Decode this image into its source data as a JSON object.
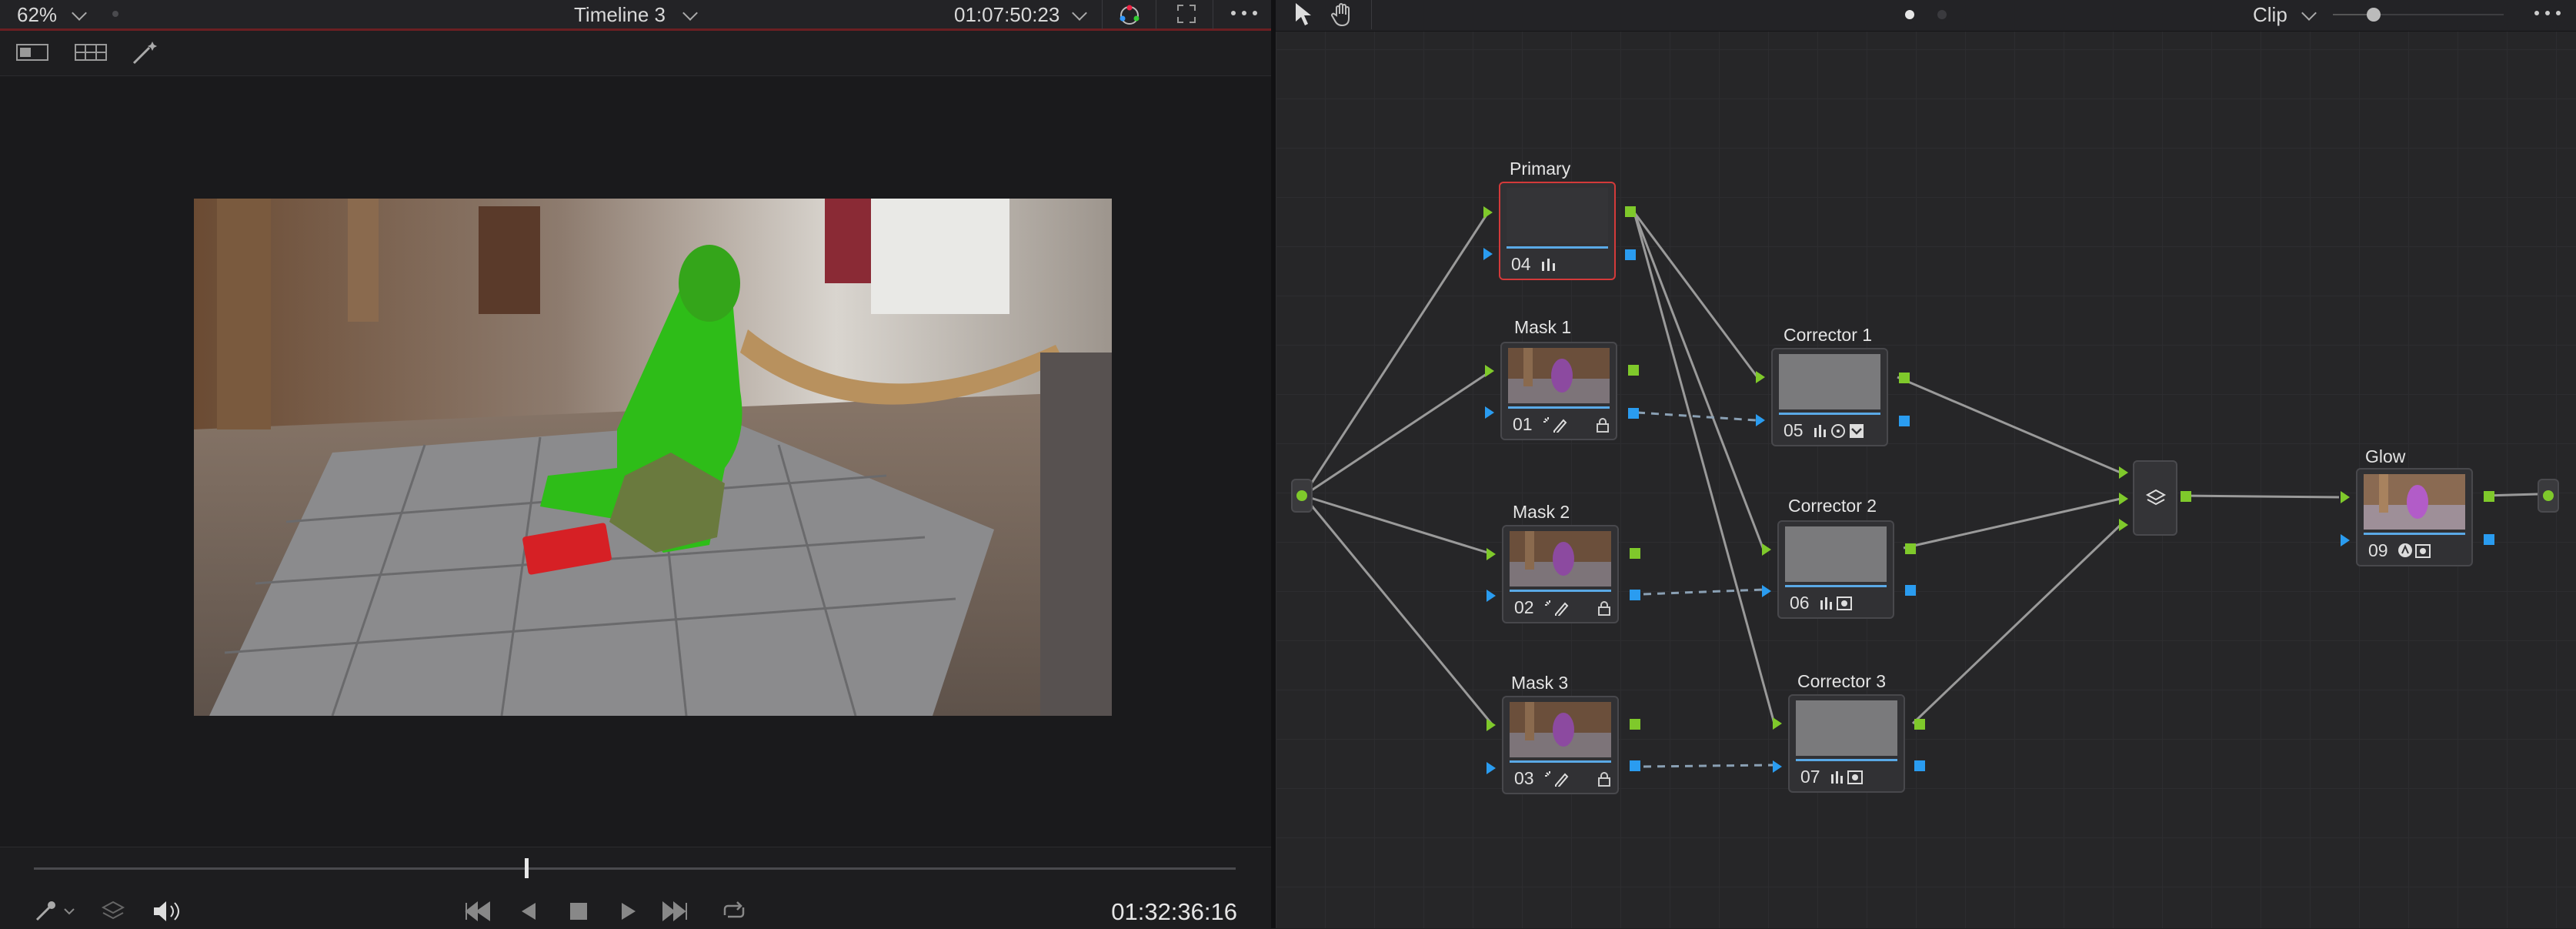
{
  "viewer": {
    "zoom": "62%",
    "timeline_name": "Timeline 3",
    "source_timecode": "01:07:50:23",
    "playhead_timecode": "01:32:36:16",
    "scrub_position": 0.41
  },
  "node_editor": {
    "mode_label": "Clip",
    "nodes": [
      {
        "id": "primary",
        "label": "Primary",
        "number": "04"
      },
      {
        "id": "mask1",
        "label": "Mask 1",
        "number": "01"
      },
      {
        "id": "mask2",
        "label": "Mask 2",
        "number": "02"
      },
      {
        "id": "mask3",
        "label": "Mask 3",
        "number": "03"
      },
      {
        "id": "corr1",
        "label": "Corrector 1",
        "number": "05"
      },
      {
        "id": "corr2",
        "label": "Corrector 2",
        "number": "06"
      },
      {
        "id": "corr3",
        "label": "Corrector 3",
        "number": "07"
      },
      {
        "id": "glow",
        "label": "Glow",
        "number": "09"
      }
    ]
  },
  "colors": {
    "rgb_output": "#7fc92b",
    "alpha_output": "#2a9cf0",
    "selected_node": "#d33a3a",
    "timeline_accent": "#6b1f22"
  },
  "icons": [
    "dropdown-chevron",
    "color-wheel-icon",
    "fullscreen-icon",
    "more-options-icon",
    "single-viewer-icon",
    "gallery-grid-icon",
    "magic-wand-icon",
    "pointer-icon",
    "hand-icon",
    "eyedropper-icon",
    "layers-icon",
    "speaker-icon",
    "skip-back-icon",
    "play-reverse-icon",
    "stop-icon",
    "play-icon",
    "skip-forward-icon",
    "loop-icon",
    "layer-mixer-icon"
  ]
}
